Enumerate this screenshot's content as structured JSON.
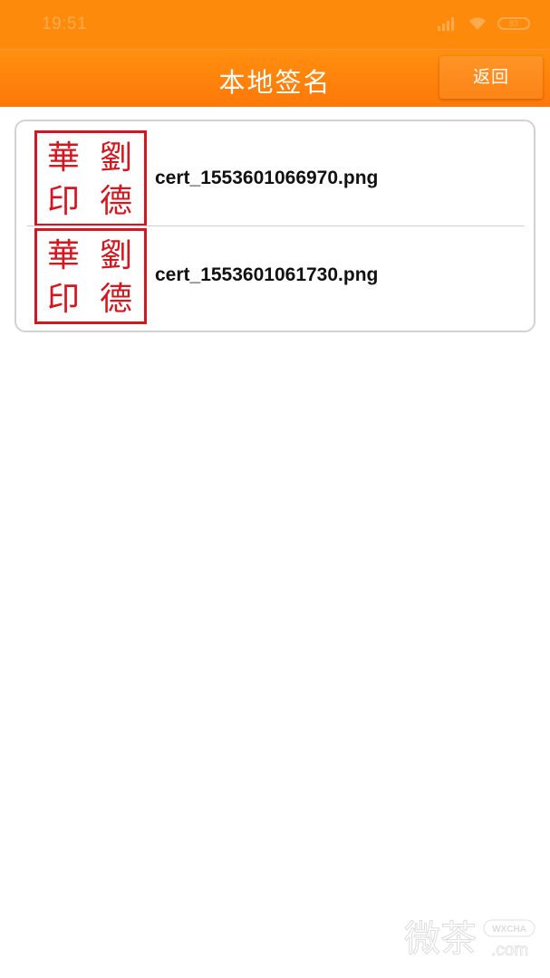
{
  "status_bar": {
    "time": "19:51",
    "signal_icon": "signal-icon",
    "wifi_icon": "wifi-icon",
    "battery_icon": "battery-icon",
    "battery_level": "83"
  },
  "header": {
    "title": "本地签名",
    "back_label": "返回"
  },
  "certificates": [
    {
      "file_name": "cert_1553601066970.png",
      "seal_chars": [
        "劉",
        "華",
        "德",
        "印"
      ],
      "seal_color": "#d8141c"
    },
    {
      "file_name": "cert_1553601061730.png",
      "seal_chars": [
        "劉",
        "華",
        "德",
        "印"
      ],
      "seal_color": "#d8141c"
    }
  ],
  "watermark": {
    "chars": "微茶",
    "brand": "WXCHA",
    "suffix": ".com"
  },
  "colors": {
    "accent": "#fe8a0c",
    "seal_red": "#d8141c",
    "list_border": "#d2d2d2"
  }
}
